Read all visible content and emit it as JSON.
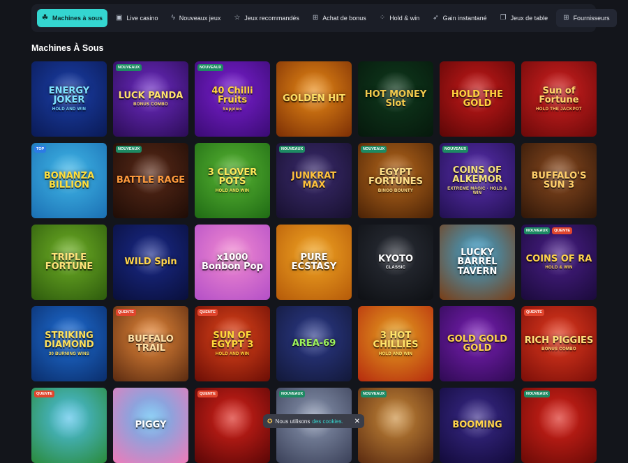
{
  "nav": {
    "items": [
      {
        "label": "Machines à sous",
        "icon": "slot-machine-icon",
        "glyph": "☘",
        "active": true
      },
      {
        "label": "Live casino",
        "icon": "live-casino-icon",
        "glyph": "▣",
        "active": false
      },
      {
        "label": "Nouveaux jeux",
        "icon": "lightning-icon",
        "glyph": "ϟ",
        "active": false
      },
      {
        "label": "Jeux recommandés",
        "icon": "star-icon",
        "glyph": "☆",
        "active": false
      },
      {
        "label": "Achat de bonus",
        "icon": "gift-icon",
        "glyph": "⊞",
        "active": false
      },
      {
        "label": "Hold & win",
        "icon": "hold-win-icon",
        "glyph": "⁘",
        "active": false
      },
      {
        "label": "Gain instantané",
        "icon": "rocket-icon",
        "glyph": "➶",
        "active": false
      },
      {
        "label": "Jeux de table",
        "icon": "cards-icon",
        "glyph": "❐",
        "active": false
      }
    ],
    "providers": {
      "label": "Fournisseurs",
      "icon": "grid-icon",
      "glyph": "⊞"
    }
  },
  "section": {
    "title": "Machines À Sous"
  },
  "games": [
    {
      "title": "ENERGY JOKER",
      "sub": "HOLD AND WIN",
      "badges": [],
      "bg": [
        "#1b3fa8",
        "#0a1a55"
      ],
      "fg": "#7fe3ff"
    },
    {
      "title": "LUCK PANDA",
      "sub": "BONUS COMBO",
      "badges": [
        "NOUVEAUX"
      ],
      "bg": [
        "#6d2bc4",
        "#2b0c55"
      ],
      "fg": "#ffe26b"
    },
    {
      "title": "40 Chilli Fruits",
      "sub": "Supplies",
      "badges": [
        "NOUVEAUX"
      ],
      "bg": [
        "#7a1fd0",
        "#3a0b73"
      ],
      "fg": "#ffd43b"
    },
    {
      "title": "GOLDEN HIT",
      "sub": "",
      "badges": [],
      "bg": [
        "#e98b16",
        "#7b2e05"
      ],
      "fg": "#ffe066"
    },
    {
      "title": "HOT MONEY Slot",
      "sub": "",
      "badges": [],
      "bg": [
        "#0f3a1d",
        "#06180c"
      ],
      "fg": "#f2c94c"
    },
    {
      "title": "HOLD THE GOLD",
      "sub": "",
      "badges": [],
      "bg": [
        "#c81a1a",
        "#5a0606"
      ],
      "fg": "#ffd23f"
    },
    {
      "title": "Sun of Fortune",
      "sub": "HOLD THE JACKPOT",
      "badges": [],
      "bg": [
        "#d12020",
        "#6a0909"
      ],
      "fg": "#ffd56b"
    },
    {
      "title": "BONANZA BILLION",
      "sub": "",
      "badges": [
        "TOP"
      ],
      "bg": [
        "#40b8e8",
        "#1b6fb3"
      ],
      "fg": "#ffde3b"
    },
    {
      "title": "BATTLE RAGE",
      "sub": "",
      "badges": [
        "NOUVEAUX"
      ],
      "bg": [
        "#5a2a18",
        "#1e0c06"
      ],
      "fg": "#ff9b3d"
    },
    {
      "title": "3 CLOVER POTS",
      "sub": "HOLD AND WIN",
      "badges": [],
      "bg": [
        "#58b533",
        "#1f6a14"
      ],
      "fg": "#ffe95a"
    },
    {
      "title": "JUNKRAT MAX",
      "sub": "",
      "badges": [
        "NOUVEAUX"
      ],
      "bg": [
        "#3b2b6e",
        "#17102e"
      ],
      "fg": "#ffc23b"
    },
    {
      "title": "EGYPT FORTUNES",
      "sub": "BINGO BOUNTY",
      "badges": [
        "NOUVEAUX"
      ],
      "bg": [
        "#b8691c",
        "#4a2206"
      ],
      "fg": "#ffe08a"
    },
    {
      "title": "COINS OF ALKEMOR",
      "sub": "EXTREME MAGIC · HOLD & WIN",
      "badges": [
        "NOUVEAUX"
      ],
      "bg": [
        "#5a2fb0",
        "#21104f"
      ],
      "fg": "#f6e27a"
    },
    {
      "title": "BUFFALO'S SUN 3",
      "sub": "",
      "badges": [],
      "bg": [
        "#8a4a1f",
        "#2e1608"
      ],
      "fg": "#ffcf6a"
    },
    {
      "title": "TRIPLE FORTUNE",
      "sub": "",
      "badges": [],
      "bg": [
        "#6fb025",
        "#2d5a0d"
      ],
      "fg": "#ffe27a"
    },
    {
      "title": "WILD Spin",
      "sub": "",
      "badges": [],
      "bg": [
        "#1a2a8a",
        "#090f3a"
      ],
      "fg": "#ffd54a"
    },
    {
      "title": "x1000 Bonbon Pop",
      "sub": "",
      "badges": [],
      "bg": [
        "#f28ad1",
        "#b34fc7"
      ],
      "fg": "#ffffff"
    },
    {
      "title": "PURE ECSTASY",
      "sub": "",
      "badges": [],
      "bg": [
        "#f2a623",
        "#b55a09"
      ],
      "fg": "#ffffff"
    },
    {
      "title": "KYOTO",
      "sub": "CLASSIC",
      "badges": [],
      "bg": [
        "#2b2f38",
        "#0e1014"
      ],
      "fg": "#ffffff"
    },
    {
      "title": "LUCKY BARREL TAVERN",
      "sub": "",
      "badges": [],
      "bg": [
        "#3aa7d8",
        "#7a3d14"
      ],
      "fg": "#ffffff"
    },
    {
      "title": "COINS OF RA",
      "sub": "HOLD & WIN",
      "badges": [
        "NOUVEAUX",
        "QUENTE"
      ],
      "bg": [
        "#4a1f88",
        "#1a0a3a"
      ],
      "fg": "#ffd34a"
    },
    {
      "title": "STRIKING DIAMOND",
      "sub": "30 BURNING WINS",
      "badges": [],
      "bg": [
        "#1f6fd6",
        "#0a2d6a"
      ],
      "fg": "#ffe15a"
    },
    {
      "title": "BUFFALO TRAIL",
      "sub": "",
      "badges": [
        "QUENTE"
      ],
      "bg": [
        "#e88a3a",
        "#5a2a10"
      ],
      "fg": "#ffe2a8"
    },
    {
      "title": "SUN OF EGYPT 3",
      "sub": "HOLD AND WIN",
      "badges": [
        "QUENTE"
      ],
      "bg": [
        "#e2461b",
        "#6a0d05"
      ],
      "fg": "#ffd93b"
    },
    {
      "title": "AREA-69",
      "sub": "",
      "badges": [],
      "bg": [
        "#2c3a8a",
        "#121838"
      ],
      "fg": "#9df25a"
    },
    {
      "title": "3 HOT CHILLIES",
      "sub": "HOLD AND WIN",
      "badges": [],
      "bg": [
        "#e6a21f",
        "#b52a0e"
      ],
      "fg": "#ffe46a"
    },
    {
      "title": "GOLD GOLD GOLD",
      "sub": "",
      "badges": [],
      "bg": [
        "#7a1fb5",
        "#2e0a52"
      ],
      "fg": "#ffd34a"
    },
    {
      "title": "RICH PIGGIES",
      "sub": "BONUS COMBO",
      "badges": [
        "QUENTE"
      ],
      "bg": [
        "#e23a1f",
        "#7a0e08"
      ],
      "fg": "#ffe07a"
    },
    {
      "title": "",
      "sub": "",
      "badges": [
        "QUENTE"
      ],
      "bg": [
        "#4fc0e8",
        "#2a8a3a"
      ],
      "fg": "#ffffff"
    },
    {
      "title": "PIGGY",
      "sub": "",
      "badges": [],
      "bg": [
        "#5ab8f0",
        "#f07ab8"
      ],
      "fg": "#ffffff"
    },
    {
      "title": "",
      "sub": "",
      "badges": [
        "QUENTE"
      ],
      "bg": [
        "#d8231a",
        "#5a0606"
      ],
      "fg": "#ffd34a"
    },
    {
      "title": "",
      "sub": "",
      "badges": [
        "NOUVEAUX"
      ],
      "bg": [
        "#8a96b0",
        "#3a4058"
      ],
      "fg": "#ffffff"
    },
    {
      "title": "",
      "sub": "",
      "badges": [
        "NOUVEAUX"
      ],
      "bg": [
        "#c88a3a",
        "#5a2a10"
      ],
      "fg": "#ffffff"
    },
    {
      "title": "BOOMING",
      "sub": "",
      "badges": [],
      "bg": [
        "#3a2a8a",
        "#120a3a"
      ],
      "fg": "#ffd34a"
    },
    {
      "title": "",
      "sub": "",
      "badges": [
        "NOUVEAUX"
      ],
      "bg": [
        "#d8231a",
        "#6a0a06"
      ],
      "fg": "#ffd34a"
    }
  ],
  "cookie": {
    "text": "Nous utilisons",
    "link": "des cookies.",
    "close": "✕",
    "icon": "cookie-icon",
    "glyph": "✪"
  }
}
